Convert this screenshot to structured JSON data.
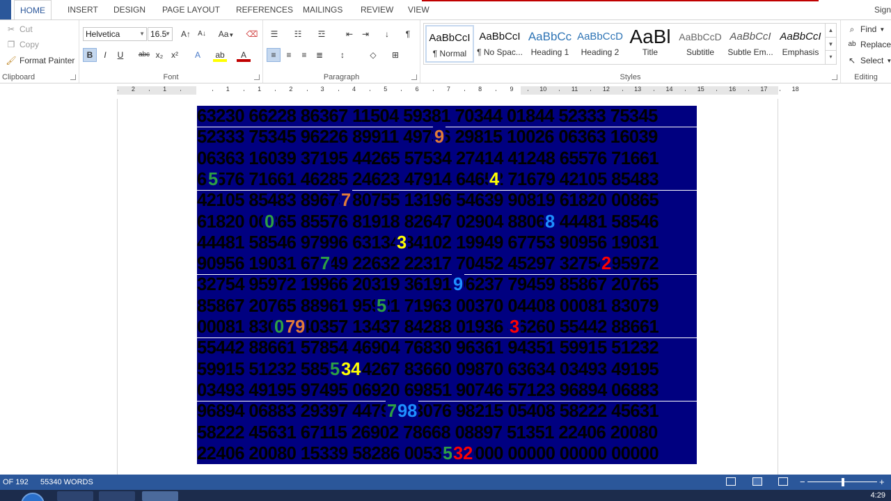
{
  "tabs": [
    "HOME",
    "INSERT",
    "DESIGN",
    "PAGE LAYOUT",
    "REFERENCES",
    "MAILINGS",
    "REVIEW",
    "VIEW"
  ],
  "sign_in": "Sign",
  "clipboard": {
    "cut": "Cut",
    "copy": "Copy",
    "format_painter": "Format Painter",
    "label": "Clipboard"
  },
  "font": {
    "name": "Helvetica",
    "size": "16.5",
    "label": "Font",
    "aa": "Aa"
  },
  "paragraph": {
    "label": "Paragraph"
  },
  "styles": {
    "label": "Styles",
    "items": [
      {
        "sample": "AaBbCcI",
        "name": "¶ Normal"
      },
      {
        "sample": "AaBbCcI",
        "name": "¶ No Spac..."
      },
      {
        "sample": "AaBbCc",
        "name": "Heading 1"
      },
      {
        "sample": "AaBbCcD",
        "name": "Heading 2"
      },
      {
        "sample": "AaBl",
        "name": "Title"
      },
      {
        "sample": "AaBbCcD",
        "name": "Subtitle"
      },
      {
        "sample": "AaBbCcI",
        "name": "Subtle Em..."
      },
      {
        "sample": "AaBbCcI",
        "name": "Emphasis"
      }
    ]
  },
  "editing": {
    "find": "Find",
    "replace": "Replace",
    "select": "Select",
    "label": "Editing"
  },
  "ruler_numbers": [
    "2",
    "1",
    "1",
    "1",
    "2",
    "3",
    "4",
    "5",
    "6",
    "7",
    "8",
    "9",
    "10",
    "11",
    "12",
    "13",
    "14",
    "15",
    "16",
    "17",
    "18"
  ],
  "document": {
    "lines": [
      "63230 66228 86367 11504 59381 70344 01844 52333 75345",
      "52333 75345 96226 89911 49736 29815 10026 06363 16039",
      "06363 16039 37195 44265 57534 27414 41248 65576 71661",
      "65576 71661 46285 24623 47914 64652 71679 42105 85483",
      "42105 85483 89675 80755 13196 54639 90819 61820 00865",
      "61820 00865 85576 81918 82647 02904 88060 44481 58546",
      "44481 58546 97996 63134 84102 19949 67753 90956 19031",
      "90956 19031 67949 22632 22317 70452 45297 32754 95972",
      "32754 95972 19966 20319 36191 96237 79459 85867 20765",
      "85867 20765 88961 95921 71963 00370 04408 00081 83079",
      "00081 83079 40357 13437 84288 01936 46260 55442 88661",
      "55442 88661 57854 46904 76830 96361 94351 59915 51232",
      "59915 51232 58534 84267 83660 09870 63634 03493 49195",
      "03493 49195 97495 06920 69851 90746 57123 96894 06883",
      "96894 06883 29397 44798 93076 98215 05408 58222 45631",
      "58222 45631 67115 26902 78668 08897 51351 22406 20080",
      "22406 20080 15339 58286 00532 00000 00000 00000 00000"
    ],
    "highlights": [
      {
        "line": 1,
        "text": "9",
        "color": "orange"
      },
      {
        "line": 3,
        "text": "5",
        "color": "green"
      },
      {
        "line": 3,
        "text": "4",
        "color": "yellow"
      },
      {
        "line": 4,
        "text": "7",
        "color": "orange"
      },
      {
        "line": 5,
        "text": "0",
        "color": "green"
      },
      {
        "line": 5,
        "text": "8",
        "color": "blue"
      },
      {
        "line": 6,
        "text": "3",
        "color": "yellow"
      },
      {
        "line": 7,
        "text": "7",
        "color": "green"
      },
      {
        "line": 7,
        "text": "2",
        "color": "red"
      },
      {
        "line": 8,
        "text": "9",
        "color": "blue"
      },
      {
        "line": 9,
        "text": "5",
        "color": "green"
      },
      {
        "line": 10,
        "text": "0",
        "color": "green"
      },
      {
        "line": 10,
        "text": "79",
        "color": "orange"
      },
      {
        "line": 10,
        "text": "3",
        "color": "red"
      },
      {
        "line": 12,
        "text": "5",
        "color": "green"
      },
      {
        "line": 12,
        "text": "34",
        "color": "yellow"
      },
      {
        "line": 14,
        "text": "7",
        "color": "green"
      },
      {
        "line": 14,
        "text": "98",
        "color": "blue"
      },
      {
        "line": 16,
        "text": "5",
        "color": "green"
      },
      {
        "line": 16,
        "text": "32",
        "color": "red"
      }
    ]
  },
  "status": {
    "page": "OF 192",
    "words": "55340 WORDS"
  },
  "clock": "4:29"
}
